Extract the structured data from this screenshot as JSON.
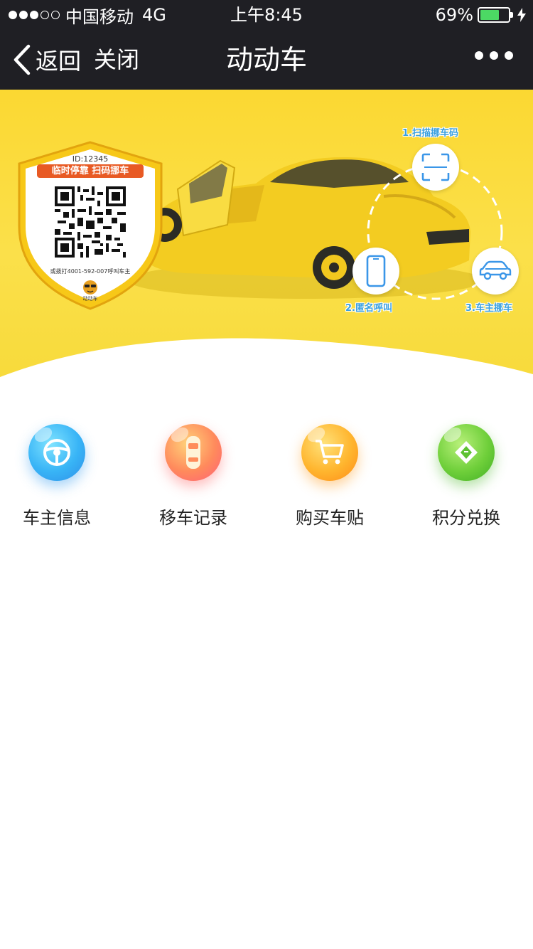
{
  "status_bar": {
    "carrier": "中国移动",
    "network": "4G",
    "time": "上午8:45",
    "battery_percent": "69%",
    "battery_level": 0.69
  },
  "nav": {
    "back_label": "返回",
    "close_label": "关闭",
    "title": "动动车"
  },
  "banner": {
    "badge": {
      "id": "ID:12345",
      "slogan": "临时停靠  扫码挪车",
      "phone": "或拨打4001-592-007呼叫车主",
      "logo_text": "动动车"
    },
    "steps": [
      {
        "label": "1.扫描挪车码",
        "icon": "scan-icon"
      },
      {
        "label": "2.匿名呼叫",
        "icon": "phone-icon"
      },
      {
        "label": "3.车主挪车",
        "icon": "car-icon"
      }
    ]
  },
  "menu": {
    "items": [
      {
        "label": "车主信息",
        "icon": "steering-wheel-icon",
        "color": "#38b4f6"
      },
      {
        "label": "移车记录",
        "icon": "car-top-icon",
        "color": "#ff7a66"
      },
      {
        "label": "购买车贴",
        "icon": "cart-icon",
        "color": "#ffa824"
      },
      {
        "label": "积分兑换",
        "icon": "gem-icon",
        "color": "#5ec232"
      }
    ]
  }
}
